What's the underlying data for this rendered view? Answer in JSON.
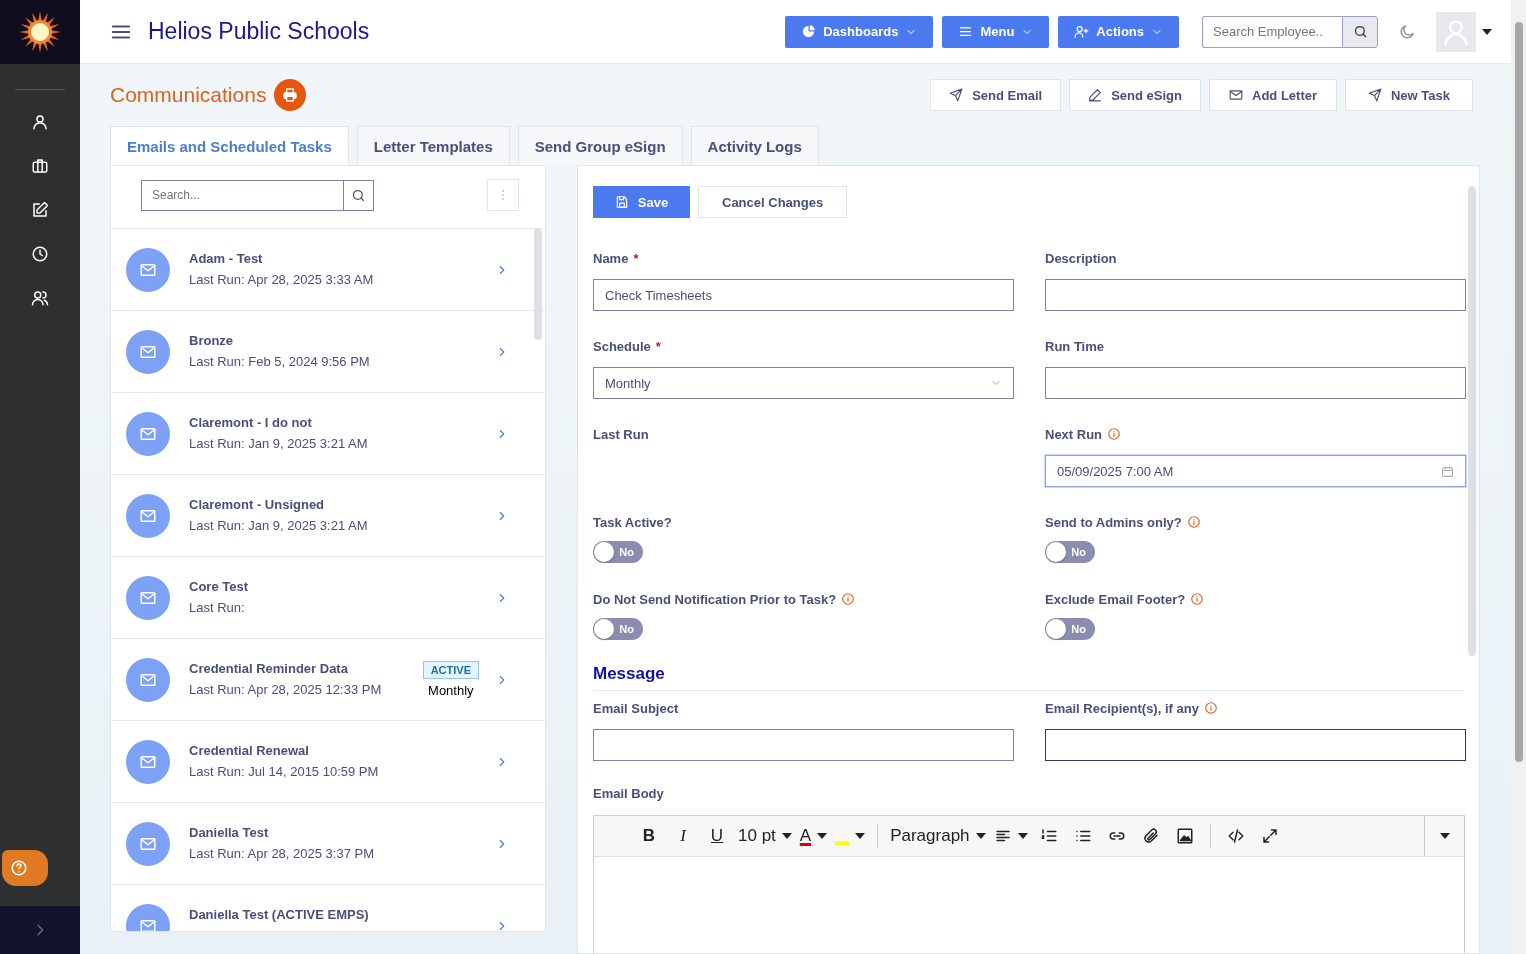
{
  "header": {
    "title": "Helios Public Schools",
    "buttons": [
      {
        "label": "Dashboards",
        "kind": "dashboards"
      },
      {
        "label": "Menu",
        "kind": "menu"
      },
      {
        "label": "Actions",
        "kind": "actions"
      }
    ],
    "search": {
      "placeholder": "Search Employee.."
    }
  },
  "page": {
    "title": "Communications",
    "actions": [
      {
        "label": "Send Email",
        "kind": "send"
      },
      {
        "label": "Send eSign",
        "kind": "sign"
      },
      {
        "label": "Add Letter",
        "kind": "letter"
      },
      {
        "label": "New Task",
        "kind": "send"
      }
    ]
  },
  "tabs": [
    {
      "label": "Emails and Scheduled Tasks",
      "selected": true
    },
    {
      "label": "Letter Templates",
      "selected": false
    },
    {
      "label": "Send Group eSign",
      "selected": false
    },
    {
      "label": "Activity Logs",
      "selected": false
    }
  ],
  "list": {
    "search": {
      "placeholder": "Search..."
    },
    "items": [
      {
        "title": "Adam - Test",
        "subtitle": "Last Run: Apr 28, 2025 3:33 AM"
      },
      {
        "title": "Bronze",
        "subtitle": "Last Run: Feb 5, 2024 9:56 PM"
      },
      {
        "title": "Claremont - I do not",
        "subtitle": "Last Run: Jan 9, 2025 3:21 AM"
      },
      {
        "title": "Claremont - Unsigned",
        "subtitle": "Last Run: Jan 9, 2025 3:21 AM"
      },
      {
        "title": "Core Test",
        "subtitle": "Last Run:"
      },
      {
        "title": "Credential Reminder Data",
        "subtitle": "Last Run: Apr 28, 2025 12:33 PM",
        "badge": "ACTIVE",
        "schedule": "Monthly"
      },
      {
        "title": "Credential Renewal",
        "subtitle": "Last Run: Jul 14, 2015 10:59 PM"
      },
      {
        "title": "Daniella Test",
        "subtitle": "Last Run: Apr 28, 2025 3:37 PM"
      },
      {
        "title": "Daniella Test (ACTIVE EMPS)"
      }
    ]
  },
  "form": {
    "save": "Save",
    "cancel": "Cancel Changes",
    "fields": [
      {
        "label": "Name",
        "required_mark": "*",
        "kind": "text",
        "value": "Check Timesheets",
        "info": false,
        "focused": false
      },
      {
        "label": "Description",
        "kind": "text",
        "info": false,
        "focused": false
      },
      {
        "label": "Schedule",
        "required_mark": "*",
        "kind": "select",
        "value": "Monthly",
        "info": false,
        "focused": false
      },
      {
        "label": "Run Time",
        "kind": "text",
        "info": false,
        "focused": false
      },
      {
        "label": "Last Run",
        "kind": "empty",
        "info": false
      },
      {
        "label": "Next Run",
        "kind": "date",
        "value": "05/09/2025 7:00 AM",
        "info": true,
        "focused": true
      }
    ],
    "toggles": [
      {
        "label": "Task Active?",
        "on": false,
        "state_text": "No",
        "info": false
      },
      {
        "label": "Send to Admins only?",
        "on": false,
        "state_text": "No",
        "info": true
      },
      {
        "label": "Do Not Send Notification Prior to Task?",
        "on": false,
        "state_text": "No",
        "info": true
      },
      {
        "label": "Exclude Email Footer?",
        "on": false,
        "state_text": "No",
        "info": true
      }
    ],
    "message": {
      "heading": "Message",
      "fields": [
        {
          "label": "Email Subject",
          "kind": "text",
          "info": false,
          "focused": false
        },
        {
          "label": "Email Recipient(s), if any",
          "kind": "text",
          "info": true,
          "focused": true
        }
      ],
      "body_label": "Email Body",
      "editor": {
        "bold": "B",
        "italic": "I",
        "underline": "U",
        "font_size": "10 pt",
        "text_color": "A",
        "block_format": "Paragraph"
      }
    }
  }
}
